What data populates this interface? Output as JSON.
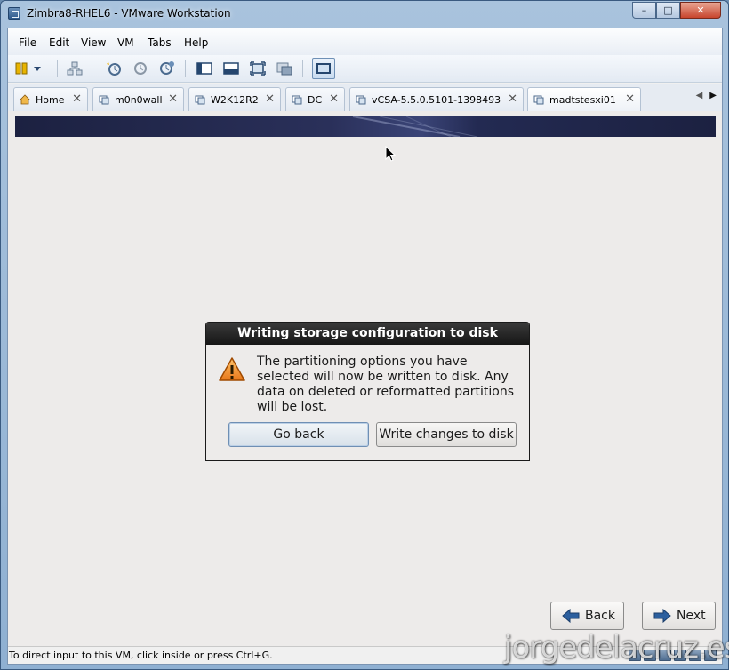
{
  "window": {
    "title": "Zimbra8-RHEL6 - VMware Workstation",
    "controls": {
      "minimize": "–",
      "maximize": "□",
      "close": "✕"
    }
  },
  "menubar": {
    "items": [
      {
        "label": "File"
      },
      {
        "label": "Edit"
      },
      {
        "label": "View"
      },
      {
        "label": "VM"
      },
      {
        "label": "Tabs"
      },
      {
        "label": "Help"
      }
    ]
  },
  "tabs": [
    {
      "label": "Home",
      "icon": "home-icon"
    },
    {
      "label": "m0n0wall",
      "icon": "vm-icon"
    },
    {
      "label": "W2K12R2",
      "icon": "vm-icon"
    },
    {
      "label": "DC",
      "icon": "vm-icon"
    },
    {
      "label": "vCSA-5.5.0.5101-1398493",
      "icon": "vm-icon"
    },
    {
      "label": "madtstesxi01",
      "icon": "vm-icon"
    }
  ],
  "tab_close": "✕",
  "dialog": {
    "title": "Writing storage configuration to disk",
    "icon": "warning-icon",
    "message": "The partitioning options you have selected will now be written to disk.  Any data on deleted or reformatted partitions will be lost.",
    "go_back_label": "Go back",
    "write_label": "Write changes to disk"
  },
  "installer_nav": {
    "back_label": "Back",
    "next_label": "Next"
  },
  "statusbar": {
    "text": "To direct input to this VM, click inside or press Ctrl+G."
  },
  "watermark": "jorgedelacruz.es",
  "colors": {
    "dialog_title_bg": "#1f1f1f",
    "vm_background": "#edebea",
    "banner": "#1c2141",
    "warning": "#f0a030"
  }
}
